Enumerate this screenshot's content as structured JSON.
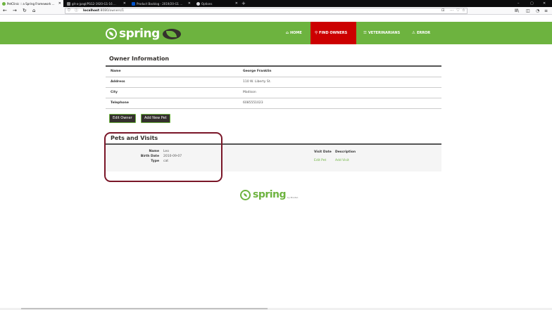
{
  "browser": {
    "tabs": [
      {
        "title": "PetClinic :: a Spring Framework ...",
        "favicon_color": "#6db33f",
        "active": true
      },
      {
        "title": "git-a-jpagl/PSG2-1920-G1-16 ...",
        "favicon_color": "#888888",
        "active": false
      },
      {
        "title": "Product Backlog - 2019/20-G1 ...",
        "favicon_color": "#0052cc",
        "active": false
      },
      {
        "title": "Options",
        "favicon_color": "#d7d7db",
        "active": false
      }
    ],
    "new_tab_label": "+",
    "url_prefix": "ⓘ",
    "url_host": "localhost",
    "url_path": ":8080/owners/1",
    "window_controls": [
      "–",
      "▢",
      "✕"
    ],
    "toolbar_icons": [
      "⊡",
      "···",
      "♡",
      "☆",
      "Ⅲ\\",
      "◫",
      "◔",
      "≡"
    ]
  },
  "header": {
    "brand": "spring",
    "menu": [
      {
        "label": "HOME",
        "icon": "⌂",
        "active": false
      },
      {
        "label": "FIND OWNERS",
        "icon": "⚲",
        "active": true
      },
      {
        "label": "VETERINARIANS",
        "icon": "☰",
        "active": false
      },
      {
        "label": "ERROR",
        "icon": "⚠",
        "active": false
      }
    ]
  },
  "owner": {
    "heading": "Owner Information",
    "rows": [
      {
        "label": "Name",
        "value": "George Franklin"
      },
      {
        "label": "Address",
        "value": "110 W. Liberty St."
      },
      {
        "label": "City",
        "value": "Madison"
      },
      {
        "label": "Telephone",
        "value": "6085551023"
      }
    ],
    "edit_button": "Edit Owner",
    "add_pet_button": "Add New Pet"
  },
  "pets": {
    "heading": "Pets and Visits",
    "name_label": "Name",
    "name_value": "Leo",
    "birth_label": "Birth Date",
    "birth_value": "2010-09-07",
    "type_label": "Type",
    "type_value": "cat",
    "visit_date_header": "Visit Date",
    "description_header": "Description",
    "edit_pet_link": "Edit Pet",
    "add_visit_link": "Add Visit"
  },
  "footer": {
    "brand": "spring",
    "sub": "by Pivotal."
  },
  "colors": {
    "brand_green": "#6db33f",
    "active_menu": "#cc0000",
    "highlight_border": "#7a1628"
  }
}
